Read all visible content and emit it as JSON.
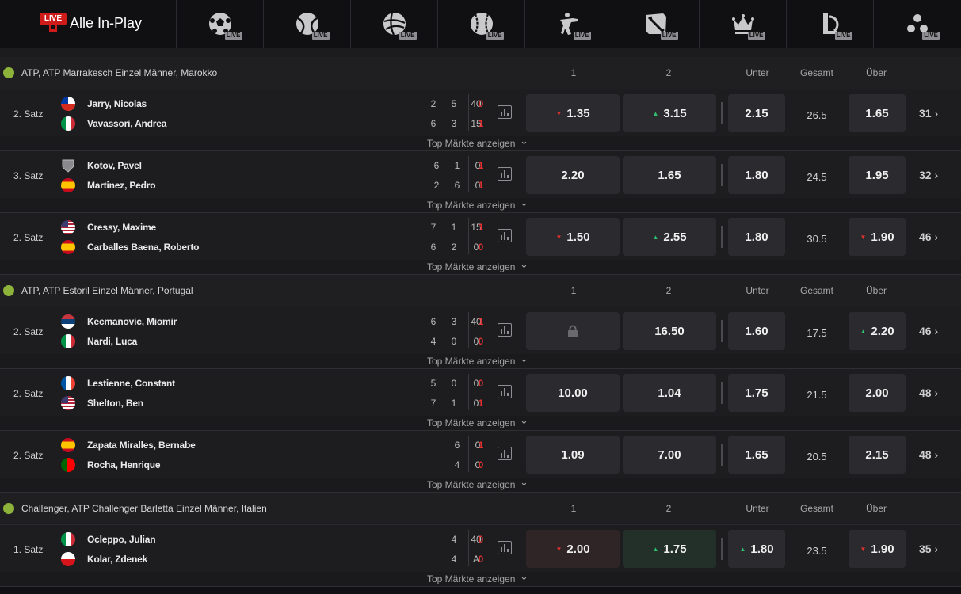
{
  "topbar": {
    "live_badge": "LIVE",
    "all_label": "Alle In-Play",
    "sports": [
      {
        "icon": "soccer-ball-icon",
        "badge": "LIVE"
      },
      {
        "icon": "tennis-ball-icon",
        "badge": "LIVE"
      },
      {
        "icon": "volleyball-icon",
        "badge": "LIVE"
      },
      {
        "icon": "baseball-icon",
        "badge": "LIVE"
      },
      {
        "icon": "counter-strike-icon",
        "badge": "LIVE"
      },
      {
        "icon": "dota-icon",
        "badge": "LIVE"
      },
      {
        "icon": "crown-icon",
        "badge": "LIVE"
      },
      {
        "icon": "league-of-legends-icon",
        "badge": "LIVE"
      },
      {
        "icon": "more-sports-icon",
        "badge": "LIVE"
      }
    ]
  },
  "columns": {
    "c1": "1",
    "c2": "2",
    "under": "Unter",
    "total": "Gesamt",
    "over": "Über"
  },
  "top_markets_label": "Top Märkte anzeigen",
  "leagues": [
    {
      "name": "ATP, ATP Marrakesch Einzel Männer, Marokko",
      "matches": [
        {
          "status": "2. Satz",
          "p1": {
            "name": "Jarry, Nicolas",
            "flag": "chile",
            "scores": [
              "2",
              "5"
            ],
            "points": "40",
            "serve": "0"
          },
          "p2": {
            "name": "Vavassori, Andrea",
            "flag": "italy",
            "scores": [
              "6",
              "3"
            ],
            "points": "15",
            "serve": "1"
          },
          "odd1": "1.35",
          "odd1_trend": "down",
          "odd2": "3.15",
          "odd2_trend": "up",
          "under": "2.15",
          "total": "26.5",
          "over": "1.65",
          "more": "31"
        },
        {
          "status": "3. Satz",
          "p1": {
            "name": "Kotov, Pavel",
            "flag": "neutral",
            "scores": [
              "6",
              "1",
              "0"
            ],
            "points": "",
            "serve": "1"
          },
          "p2": {
            "name": "Martinez, Pedro",
            "flag": "spain",
            "scores": [
              "2",
              "6",
              "0"
            ],
            "points": "",
            "serve": "1"
          },
          "odd1": "2.20",
          "odd2": "1.65",
          "under": "1.80",
          "total": "24.5",
          "over": "1.95",
          "more": "32"
        },
        {
          "status": "2. Satz",
          "p1": {
            "name": "Cressy, Maxime",
            "flag": "usa",
            "scores": [
              "7",
              "1"
            ],
            "points": "15",
            "serve": "1"
          },
          "p2": {
            "name": "Carballes Baena, Roberto",
            "flag": "spain",
            "scores": [
              "6",
              "2"
            ],
            "points": "0",
            "serve": "0"
          },
          "odd1": "1.50",
          "odd1_trend": "down",
          "odd2": "2.55",
          "odd2_trend": "up",
          "under": "1.80",
          "total": "30.5",
          "over": "1.90",
          "over_trend": "down",
          "more": "46"
        }
      ]
    },
    {
      "name": "ATP, ATP Estoril Einzel Männer, Portugal",
      "matches": [
        {
          "status": "2. Satz",
          "p1": {
            "name": "Kecmanovic, Miomir",
            "flag": "serbia",
            "scores": [
              "6",
              "3"
            ],
            "points": "40",
            "serve": "1"
          },
          "p2": {
            "name": "Nardi, Luca",
            "flag": "italy",
            "scores": [
              "4",
              "0"
            ],
            "points": "0",
            "serve": "0"
          },
          "odd1": "",
          "odd1_locked": true,
          "odd2": "16.50",
          "under": "1.60",
          "total": "17.5",
          "over": "2.20",
          "over_trend": "up",
          "more": "46"
        },
        {
          "status": "2. Satz",
          "p1": {
            "name": "Lestienne, Constant",
            "flag": "france",
            "scores": [
              "5",
              "0"
            ],
            "points": "0",
            "serve": "0"
          },
          "p2": {
            "name": "Shelton, Ben",
            "flag": "usa",
            "scores": [
              "7",
              "1"
            ],
            "points": "0",
            "serve": "1"
          },
          "odd1": "10.00",
          "odd2": "1.04",
          "under": "1.75",
          "total": "21.5",
          "over": "2.00",
          "more": "48"
        },
        {
          "status": "2. Satz",
          "p1": {
            "name": "Zapata Miralles, Bernabe",
            "flag": "spain",
            "scores": [
              "6",
              "0"
            ],
            "points": "",
            "serve": "1"
          },
          "p2": {
            "name": "Rocha, Henrique",
            "flag": "portugal",
            "scores": [
              "4",
              "0"
            ],
            "points": "",
            "serve": "0"
          },
          "odd1": "1.09",
          "odd2": "7.00",
          "under": "1.65",
          "total": "20.5",
          "over": "2.15",
          "more": "48"
        }
      ]
    },
    {
      "name": "Challenger, ATP Challenger Barletta Einzel Männer, Italien",
      "matches": [
        {
          "status": "1. Satz",
          "p1": {
            "name": "Ocleppo, Julian",
            "flag": "italy",
            "scores": [
              "4"
            ],
            "points": "40",
            "serve": "0"
          },
          "p2": {
            "name": "Kolar, Zdenek",
            "flag": "czech",
            "scores": [
              "4"
            ],
            "points": "A",
            "serve": "0"
          },
          "odd1": "2.00",
          "odd1_trend": "down",
          "odd1_bg": "down",
          "odd2": "1.75",
          "odd2_trend": "up",
          "odd2_bg": "up",
          "under": "1.80",
          "under_trend": "up",
          "total": "23.5",
          "over": "1.90",
          "over_trend": "down",
          "more": "35"
        }
      ]
    }
  ],
  "colors": {
    "red": "#e03030",
    "green": "#2fbf6e",
    "live_red": "#d01b1b",
    "tennis_green": "#8db33b"
  }
}
